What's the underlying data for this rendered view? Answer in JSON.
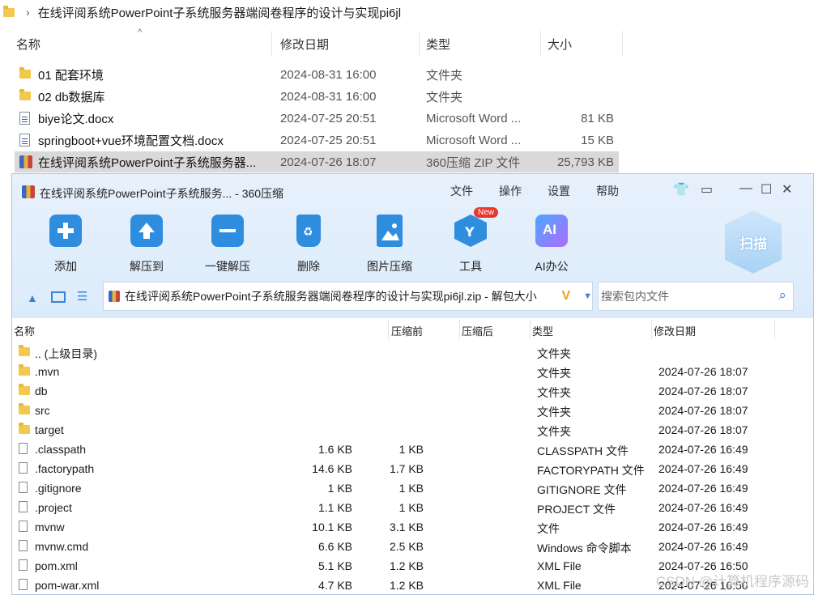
{
  "explorer": {
    "breadcrumb": "在线评阅系统PowerPoint子系统服务器端阅卷程序的设计与实现pi6jl",
    "columns": {
      "name": "名称",
      "modified": "修改日期",
      "type": "类型",
      "size": "大小"
    },
    "rows": [
      {
        "name": "01 配套环境",
        "modified": "2024-08-31 16:00",
        "type": "文件夹",
        "size": ""
      },
      {
        "name": "02 db数据库",
        "modified": "2024-08-31 16:00",
        "type": "文件夹",
        "size": ""
      },
      {
        "name": "biye论文.docx",
        "modified": "2024-07-25 20:51",
        "type": "Microsoft Word ...",
        "size": "81 KB"
      },
      {
        "name": "springboot+vue环境配置文档.docx",
        "modified": "2024-07-25 20:51",
        "type": "Microsoft Word ...",
        "size": "15 KB"
      },
      {
        "name": "在线评阅系统PowerPoint子系统服务器...",
        "modified": "2024-07-26 18:07",
        "type": "360压缩 ZIP 文件",
        "size": "25,793 KB"
      }
    ]
  },
  "zip": {
    "title": "在线评阅系统PowerPoint子系统服务... - 360压缩",
    "menu": [
      "文件",
      "操作",
      "设置",
      "帮助"
    ],
    "tools": [
      {
        "label": "添加",
        "icon": "add-icon"
      },
      {
        "label": "解压到",
        "icon": "extract-to-icon"
      },
      {
        "label": "一键解压",
        "icon": "one-click-extract-icon"
      },
      {
        "label": "删除",
        "icon": "delete-icon"
      },
      {
        "label": "图片压缩",
        "icon": "image-compress-icon"
      },
      {
        "label": "工具",
        "icon": "tools-icon"
      },
      {
        "label": "AI办公",
        "icon": "ai-office-icon"
      }
    ],
    "new_badge": "New",
    "ai_icon_text": "AI",
    "scan_label": "扫描",
    "path": "在线评阅系统PowerPoint子系统服务器端阅卷程序的设计与实现pi6jl.zip - 解包大小",
    "search_placeholder": "搜索包内文件",
    "columns": {
      "name": "名称",
      "compressed_before": "压缩前",
      "compressed_after": "压缩后",
      "type": "类型",
      "modified": "修改日期"
    },
    "rows": [
      {
        "name": ".. (上级目录)",
        "before": "",
        "after": "",
        "type": "文件夹",
        "modified": "",
        "kind": "folder"
      },
      {
        "name": ".mvn",
        "before": "",
        "after": "",
        "type": "文件夹",
        "modified": "2024-07-26 18:07",
        "kind": "folder"
      },
      {
        "name": "db",
        "before": "",
        "after": "",
        "type": "文件夹",
        "modified": "2024-07-26 18:07",
        "kind": "folder"
      },
      {
        "name": "src",
        "before": "",
        "after": "",
        "type": "文件夹",
        "modified": "2024-07-26 18:07",
        "kind": "folder"
      },
      {
        "name": "target",
        "before": "",
        "after": "",
        "type": "文件夹",
        "modified": "2024-07-26 18:07",
        "kind": "folder"
      },
      {
        "name": ".classpath",
        "before": "1.6 KB",
        "after": "1 KB",
        "type": "CLASSPATH 文件",
        "modified": "2024-07-26 16:49",
        "kind": "file"
      },
      {
        "name": ".factorypath",
        "before": "14.6 KB",
        "after": "1.7 KB",
        "type": "FACTORYPATH 文件",
        "modified": "2024-07-26 16:49",
        "kind": "file"
      },
      {
        "name": ".gitignore",
        "before": "1 KB",
        "after": "1 KB",
        "type": "GITIGNORE 文件",
        "modified": "2024-07-26 16:49",
        "kind": "file"
      },
      {
        "name": ".project",
        "before": "1.1 KB",
        "after": "1 KB",
        "type": "PROJECT 文件",
        "modified": "2024-07-26 16:49",
        "kind": "file"
      },
      {
        "name": "mvnw",
        "before": "10.1 KB",
        "after": "3.1 KB",
        "type": "文件",
        "modified": "2024-07-26 16:49",
        "kind": "file"
      },
      {
        "name": "mvnw.cmd",
        "before": "6.6 KB",
        "after": "2.5 KB",
        "type": "Windows 命令脚本",
        "modified": "2024-07-26 16:49",
        "kind": "cmd"
      },
      {
        "name": "pom.xml",
        "before": "5.1 KB",
        "after": "1.2 KB",
        "type": "XML File",
        "modified": "2024-07-26 16:50",
        "kind": "file"
      },
      {
        "name": "pom-war.xml",
        "before": "4.7 KB",
        "after": "1.2 KB",
        "type": "XML File",
        "modified": "2024-07-26 16:50",
        "kind": "file"
      }
    ]
  },
  "watermark": "CSDN @计算机程序源码"
}
